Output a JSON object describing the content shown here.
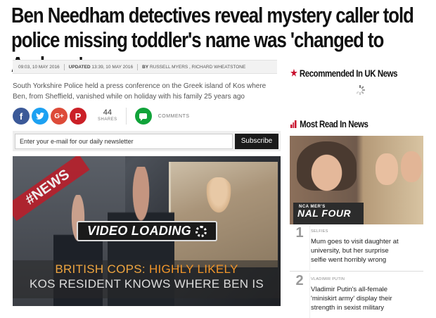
{
  "article": {
    "headline_line1": "Ben Needham detectives reveal mystery caller told",
    "headline_line2": "police missing toddler's name was 'changed to Andreas'",
    "byline": {
      "published": "09:03, 10 MAY 2016",
      "updated_label": "UPDATED",
      "updated": "13:39, 10 MAY 2016",
      "by_label": "BY",
      "authors": "RUSSELL MYERS , RICHARD WHEATSTONE"
    },
    "standfirst": "South Yorkshire Police held a press conference on the Greek island of Kos where Ben, from Sheffield, vanished while on holiday with his family 25 years ago",
    "share": {
      "count": "44",
      "count_label": "SHARES",
      "comments_label": "COMMENTS",
      "icons": [
        "facebook-icon",
        "twitter-icon",
        "google-plus-icon",
        "pinterest-icon",
        "comments-icon"
      ],
      "colors": {
        "facebook": "#3b5998",
        "twitter": "#1da1f2",
        "google_plus": "#dd4b39",
        "pinterest": "#cb2027",
        "comments": "#11a33a"
      }
    },
    "newsletter": {
      "placeholder": "Enter your e-mail for our daily newsletter",
      "button": "Subscribe"
    },
    "video": {
      "tag": "#NEWS",
      "loading": "VIDEO LOADING",
      "caption_highlight": "BRITISH COPS:",
      "caption_rest": "HIGHLY LIKELY",
      "caption_line2": "KOS RESIDENT KNOWS WHERE BEN IS"
    }
  },
  "sidebar": {
    "recommended_title": "Recommended In UK News",
    "most_read_title": "Most Read In News",
    "most_read_image_text": "NAL FOUR",
    "most_read_image_small": "NCA  MER'S",
    "items": [
      {
        "num": "1",
        "category": "SELFIES",
        "text": "Mum goes to visit daughter at university, but her surprise selfie went horribly wrong"
      },
      {
        "num": "2",
        "category": "VLADIMIR PUTIN",
        "text": "Vladimir Putin's all-female 'miniskirt army' display their strength in sexist military"
      }
    ],
    "accent_color": "#c8102e"
  }
}
